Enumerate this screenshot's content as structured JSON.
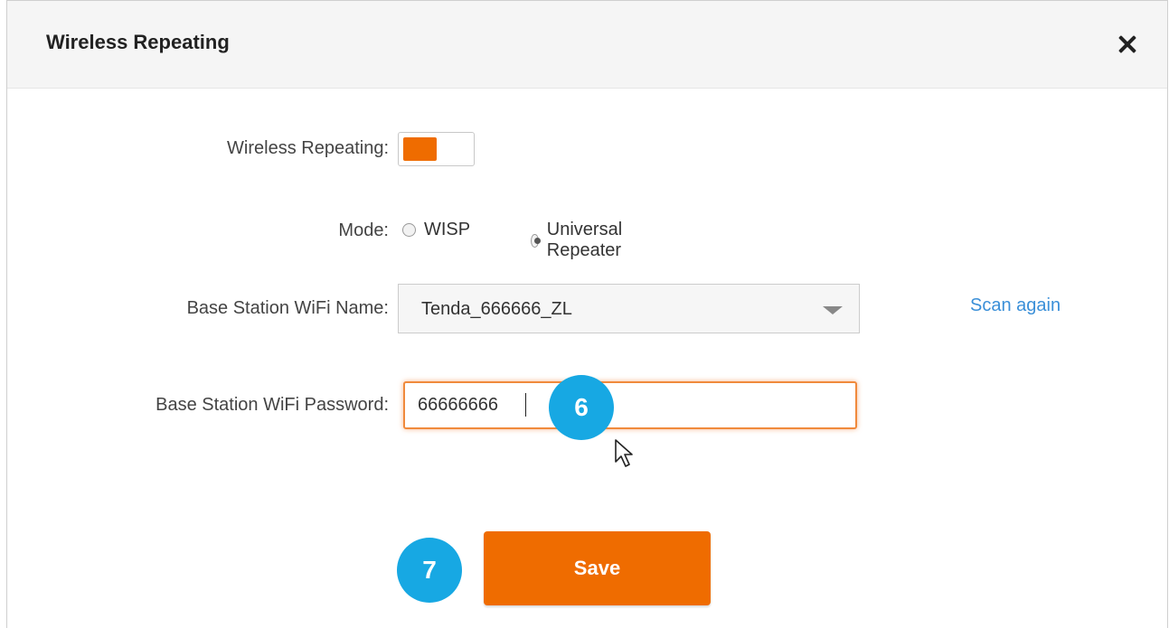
{
  "dialog": {
    "title": "Wireless Repeating",
    "close_icon": "close-icon"
  },
  "form": {
    "repeating_label": "Wireless Repeating:",
    "repeating_enabled": true,
    "mode_label": "Mode:",
    "mode_options": [
      "WISP",
      "Universal Repeater"
    ],
    "mode_selected": "Universal Repeater",
    "ssid_label": "Base Station WiFi Name:",
    "ssid_value": "Tenda_666666_ZL",
    "scan_label": "Scan again",
    "password_label": "Base Station WiFi Password:",
    "password_value": "66666666",
    "save_label": "Save"
  },
  "annotations": {
    "step_6": "6",
    "step_7": "7"
  },
  "colors": {
    "accent": "#ef6c00",
    "link": "#3a8fd8",
    "badge": "#17a8e3"
  }
}
